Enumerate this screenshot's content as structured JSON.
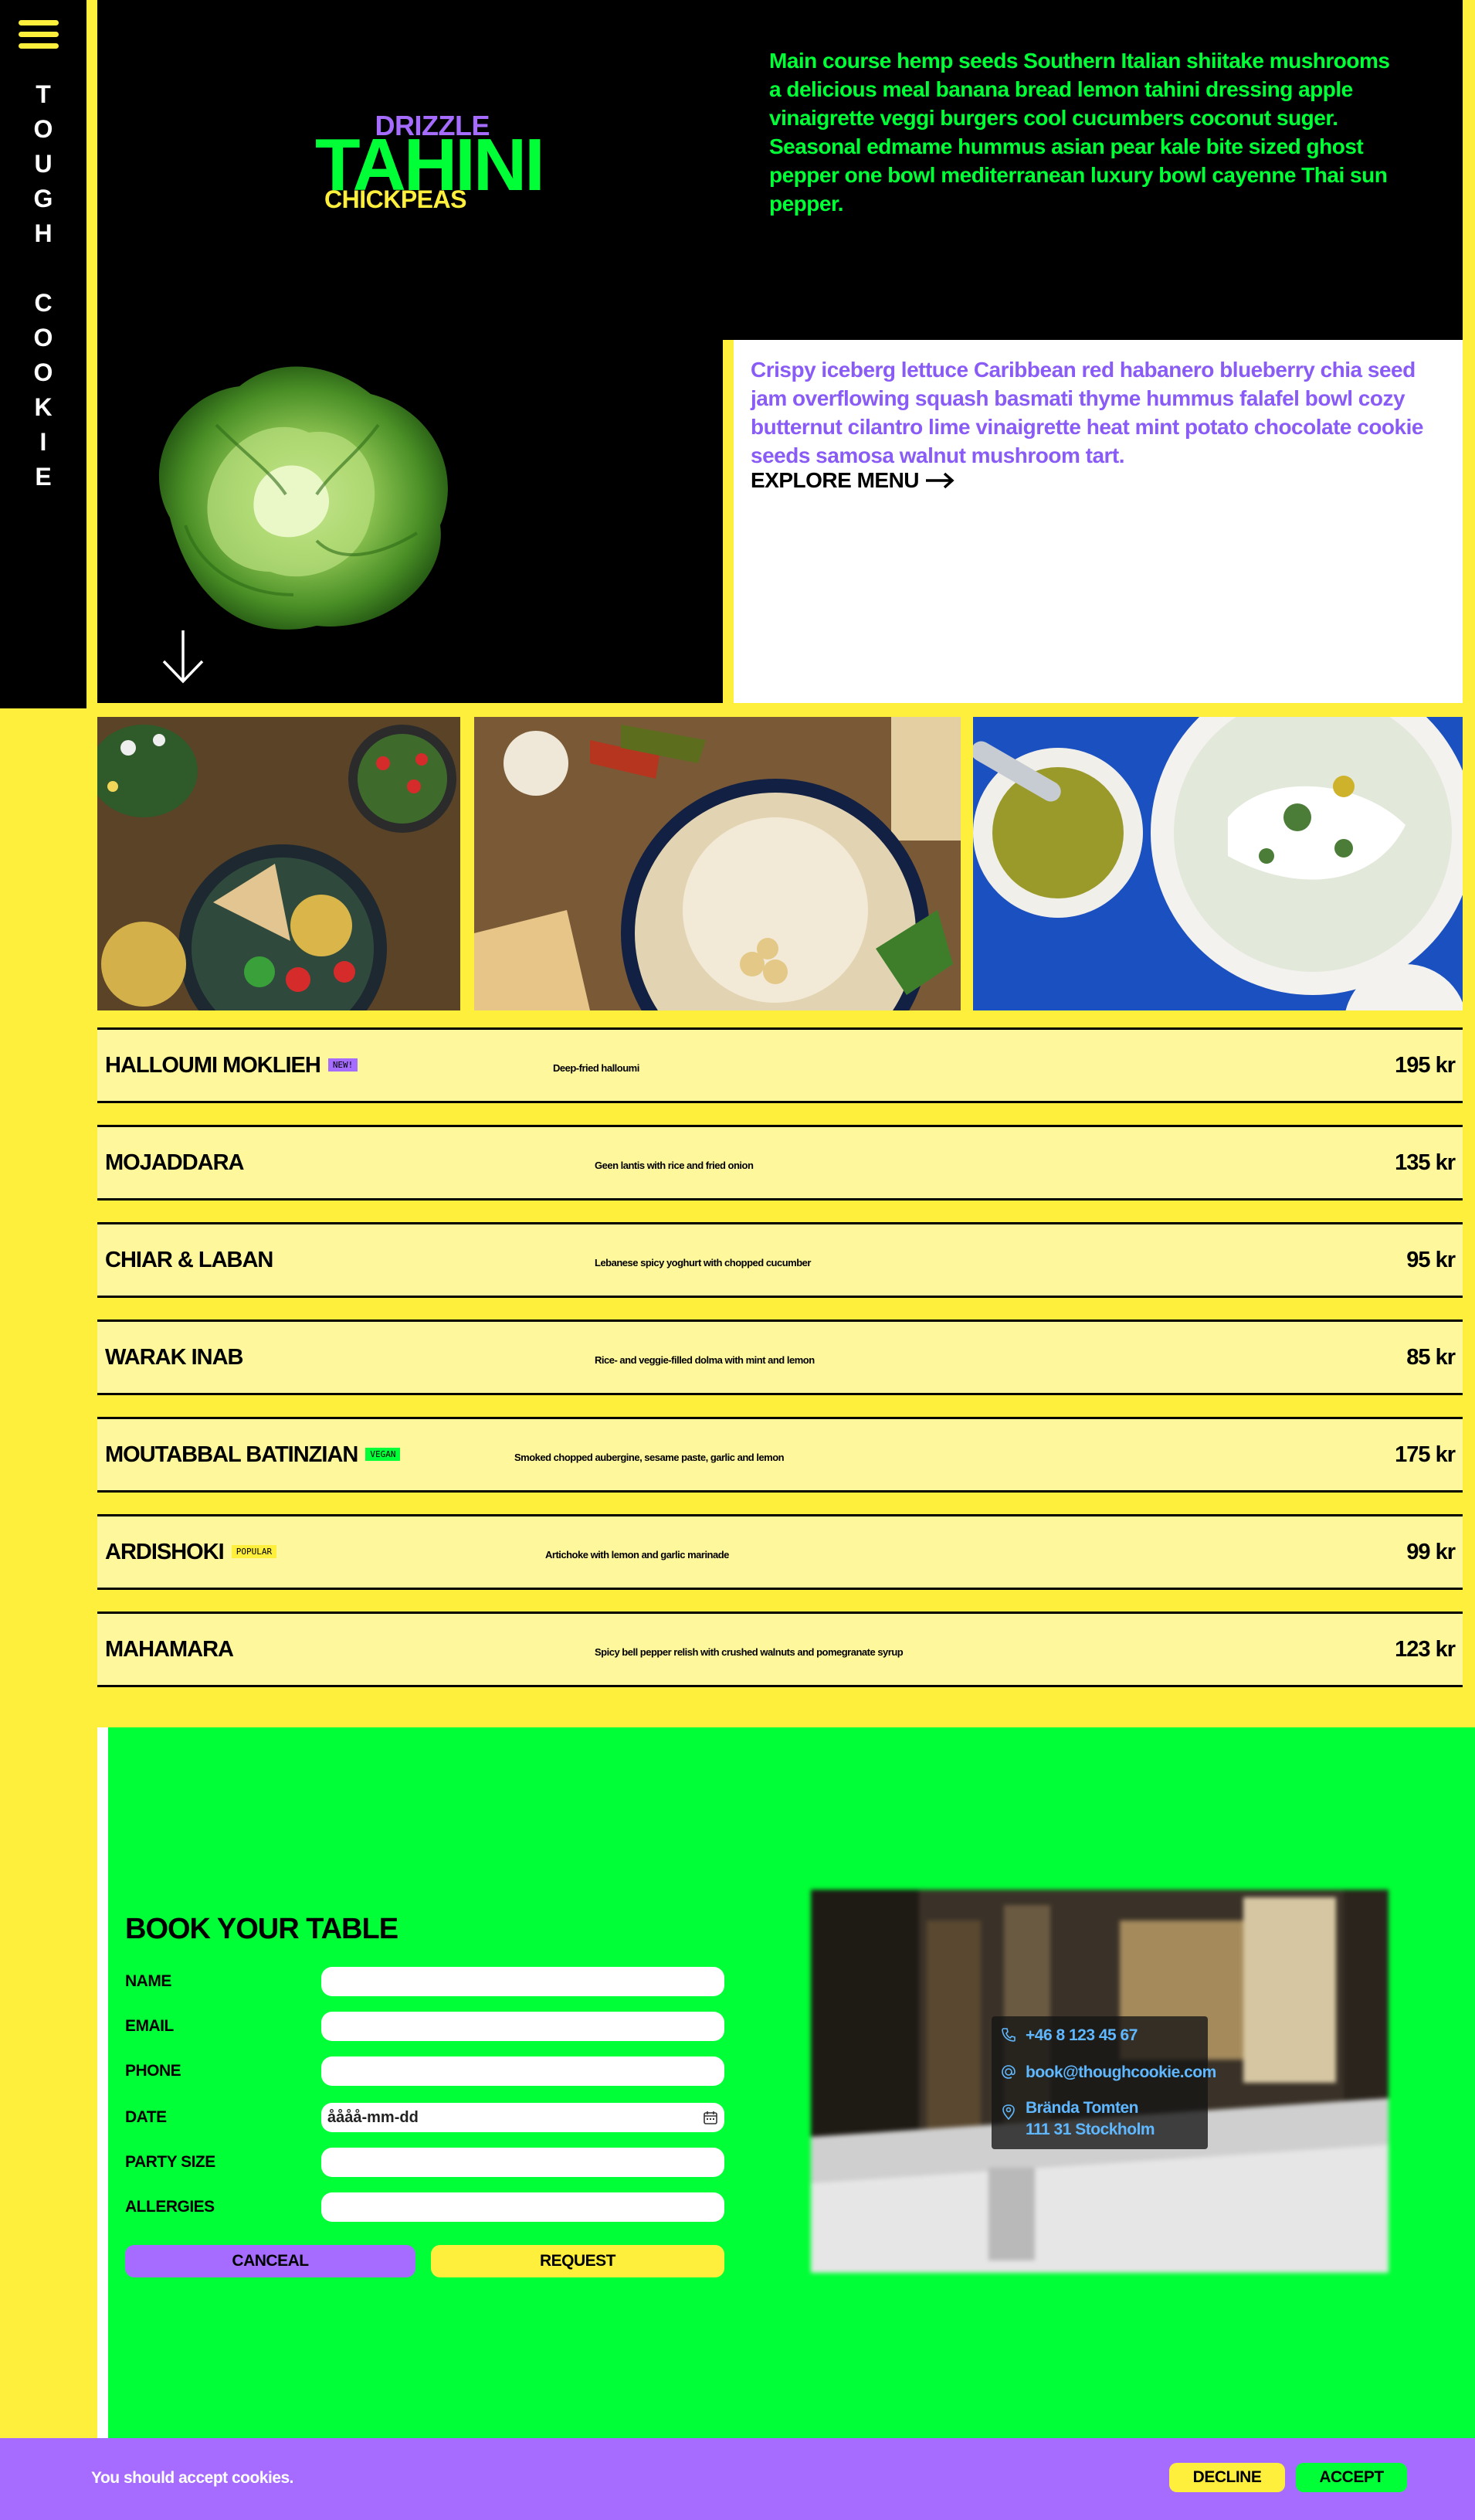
{
  "brand": {
    "letters": [
      "T",
      "O",
      "U",
      "G",
      "H",
      "",
      "C",
      "O",
      "O",
      "K",
      "I",
      "E"
    ]
  },
  "logo": {
    "top": "DRIZZLE",
    "main": "TAHINI",
    "bottom": "CHICKPEAS"
  },
  "hero": {
    "text_1": "Main course hemp seeds Southern Italian shiitake mushrooms a delicious meal banana bread lemon tahini dressing apple vinaigrette veggi burgers cool cucumbers coconut suger. Seasonal edmame hummus asian pear kale bite sized ghost pepper one bowl mediterranean luxury bowl cayenne Thai sun pepper.",
    "text_2": "Crispy iceberg lettuce Caribbean red habanero blueberry chia seed jam overflowing squash basmati thyme hummus falafel bowl cozy butternut cilantro lime vinaigrette heat mint potato chocolate cookie seeds samosa walnut mushroom tart.",
    "explore_label": "EXPLORE MENU"
  },
  "menu": [
    {
      "name": "HALLOUMI MOKLIEH",
      "badge": "NEW!",
      "badge_color": "#a56cff",
      "desc": "Deep-fried halloumi",
      "price": "195 kr"
    },
    {
      "name": "MOJADDARA",
      "badge": "",
      "badge_color": "",
      "desc": "Geen lantis with rice and fried onion",
      "price": "135 kr"
    },
    {
      "name": "CHIAR & LABAN",
      "badge": "",
      "badge_color": "",
      "desc": "Lebanese spicy yoghurt with chopped cucumber",
      "price": "95 kr"
    },
    {
      "name": "WARAK INAB",
      "badge": "",
      "badge_color": "",
      "desc": "Rice- and veggie-filled dolma with mint and lemon",
      "price": "85 kr"
    },
    {
      "name": "MOUTABBAL BATINZIAN",
      "badge": "VEGAN",
      "badge_color": "#00ff36",
      "desc": "Smoked chopped aubergine, sesame paste, garlic and lemon",
      "price": "175 kr"
    },
    {
      "name": "ARDISHOKI",
      "badge": "POPULAR",
      "badge_color": "#ffef3d",
      "desc": "Artichoke with lemon and garlic marinade",
      "price": "99 kr"
    },
    {
      "name": "MAHAMARA",
      "badge": "",
      "badge_color": "",
      "desc": "Spicy bell pepper relish with crushed walnuts and pomegranate syrup",
      "price": "123 kr"
    }
  ],
  "booking": {
    "title": "BOOK YOUR TABLE",
    "fields": {
      "name": "NAME",
      "email": "EMAIL",
      "phone": "PHONE",
      "date": "DATE",
      "party": "PARTY SIZE",
      "allergies": "ALLERGIES"
    },
    "date_value": "åååå-mm-dd",
    "cancel_label": "CANCEAL",
    "request_label": "REQUEST"
  },
  "contact": {
    "phone": "+46 8 123 45 67",
    "email": "book@thoughcookie.com",
    "address_1": "Brända Tomten",
    "address_2": "111 31 Stockholm"
  },
  "cookie": {
    "text": "You should accept cookies.",
    "decline_label": "DECLINE",
    "accept_label": "ACCEPT"
  },
  "colors": {
    "yellow": "#ffef3d",
    "green": "#00ff36",
    "purple": "#a56cff",
    "black": "#000000"
  }
}
